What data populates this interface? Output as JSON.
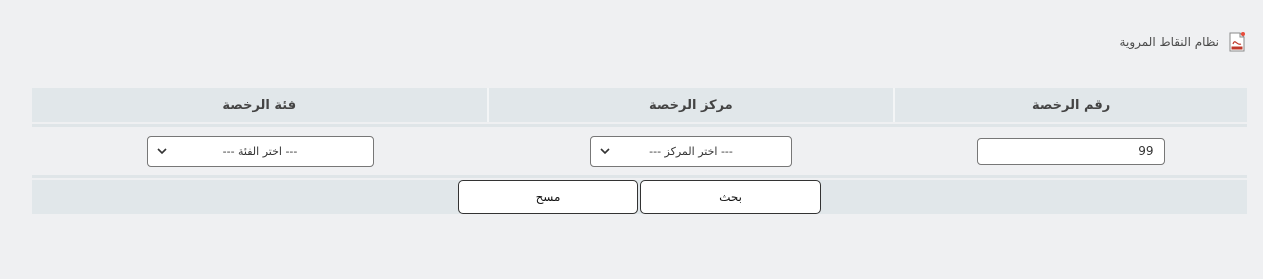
{
  "header": {
    "pdf_link_label": "نظام النقاط المروية",
    "pdf_icon": "pdf-file-icon"
  },
  "form": {
    "columns": [
      {
        "key": "license_number",
        "label": "رقم الرخصة"
      },
      {
        "key": "license_center",
        "label": "مركز الرخصة"
      },
      {
        "key": "license_class",
        "label": "فئة الرخصة"
      }
    ],
    "license_number_value": "99",
    "license_center_selected": "--- اختر المركز ---",
    "license_class_selected": "--- اختر الفئة ---"
  },
  "buttons": {
    "search_label": "بحث",
    "clear_label": "مسح"
  }
}
